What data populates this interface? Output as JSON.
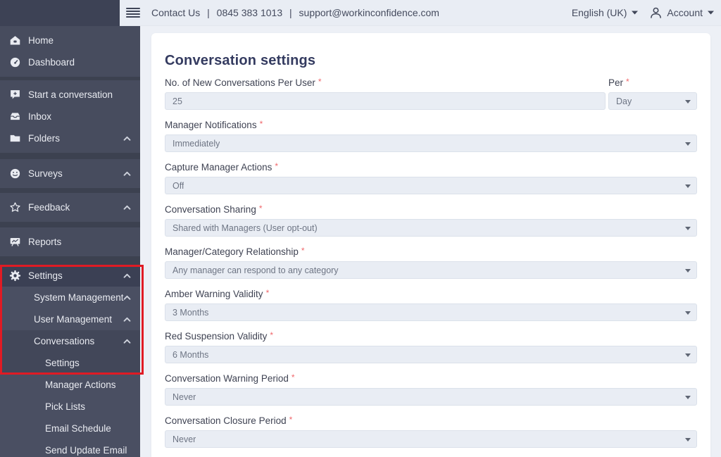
{
  "topbar": {
    "contact_us": "Contact Us",
    "separator": "|",
    "phone": "0845 383 1013",
    "email": "support@workinconfidence.com",
    "language": "English (UK)",
    "account": "Account"
  },
  "sidebar": {
    "items": [
      {
        "label": "Home",
        "icon": "home-icon"
      },
      {
        "label": "Dashboard",
        "icon": "dashboard-icon"
      },
      {
        "label": "Start a conversation",
        "icon": "chat-plus-icon"
      },
      {
        "label": "Inbox",
        "icon": "inbox-icon"
      },
      {
        "label": "Folders",
        "icon": "folder-icon",
        "chevron": "up"
      },
      {
        "label": "Surveys",
        "icon": "smiley-icon",
        "chevron": "up"
      },
      {
        "label": "Feedback",
        "icon": "star-icon",
        "chevron": "up"
      },
      {
        "label": "Reports",
        "icon": "presentation-chart-icon"
      },
      {
        "label": "Settings",
        "icon": "gear-icon",
        "chevron": "up"
      },
      {
        "label": "System Management",
        "chevron": "up"
      },
      {
        "label": "User Management",
        "chevron": "up"
      },
      {
        "label": "Conversations",
        "chevron": "up"
      },
      {
        "label": "Settings"
      },
      {
        "label": "Manager Actions"
      },
      {
        "label": "Pick Lists"
      },
      {
        "label": "Email Schedule"
      },
      {
        "label": "Send Update Email"
      }
    ]
  },
  "form": {
    "title": "Conversation settings",
    "required_marker": "*",
    "fields": [
      {
        "label": "No. of New Conversations Per User",
        "value": "25",
        "control": "text"
      },
      {
        "label": "Per",
        "value": "Day",
        "control": "select"
      },
      {
        "label": "Manager Notifications",
        "value": "Immediately",
        "control": "select"
      },
      {
        "label": "Capture Manager Actions",
        "value": "Off",
        "control": "select"
      },
      {
        "label": "Conversation Sharing",
        "value": "Shared with Managers (User opt-out)",
        "control": "select"
      },
      {
        "label": "Manager/Category Relationship",
        "value": "Any manager can respond to any category",
        "control": "select"
      },
      {
        "label": "Amber Warning Validity",
        "value": "3 Months",
        "control": "select"
      },
      {
        "label": "Red Suspension Validity",
        "value": "6 Months",
        "control": "select"
      },
      {
        "label": "Conversation Warning Period",
        "value": "Never",
        "control": "select"
      },
      {
        "label": "Conversation Closure Period",
        "value": "Never",
        "control": "select"
      }
    ]
  },
  "colors": {
    "annotation_red": "#e01b24",
    "required_red": "#f0686c",
    "sidebar_bg": "#474c5e",
    "topbar_bg": "#e9edf4",
    "title_navy": "#343b60"
  }
}
